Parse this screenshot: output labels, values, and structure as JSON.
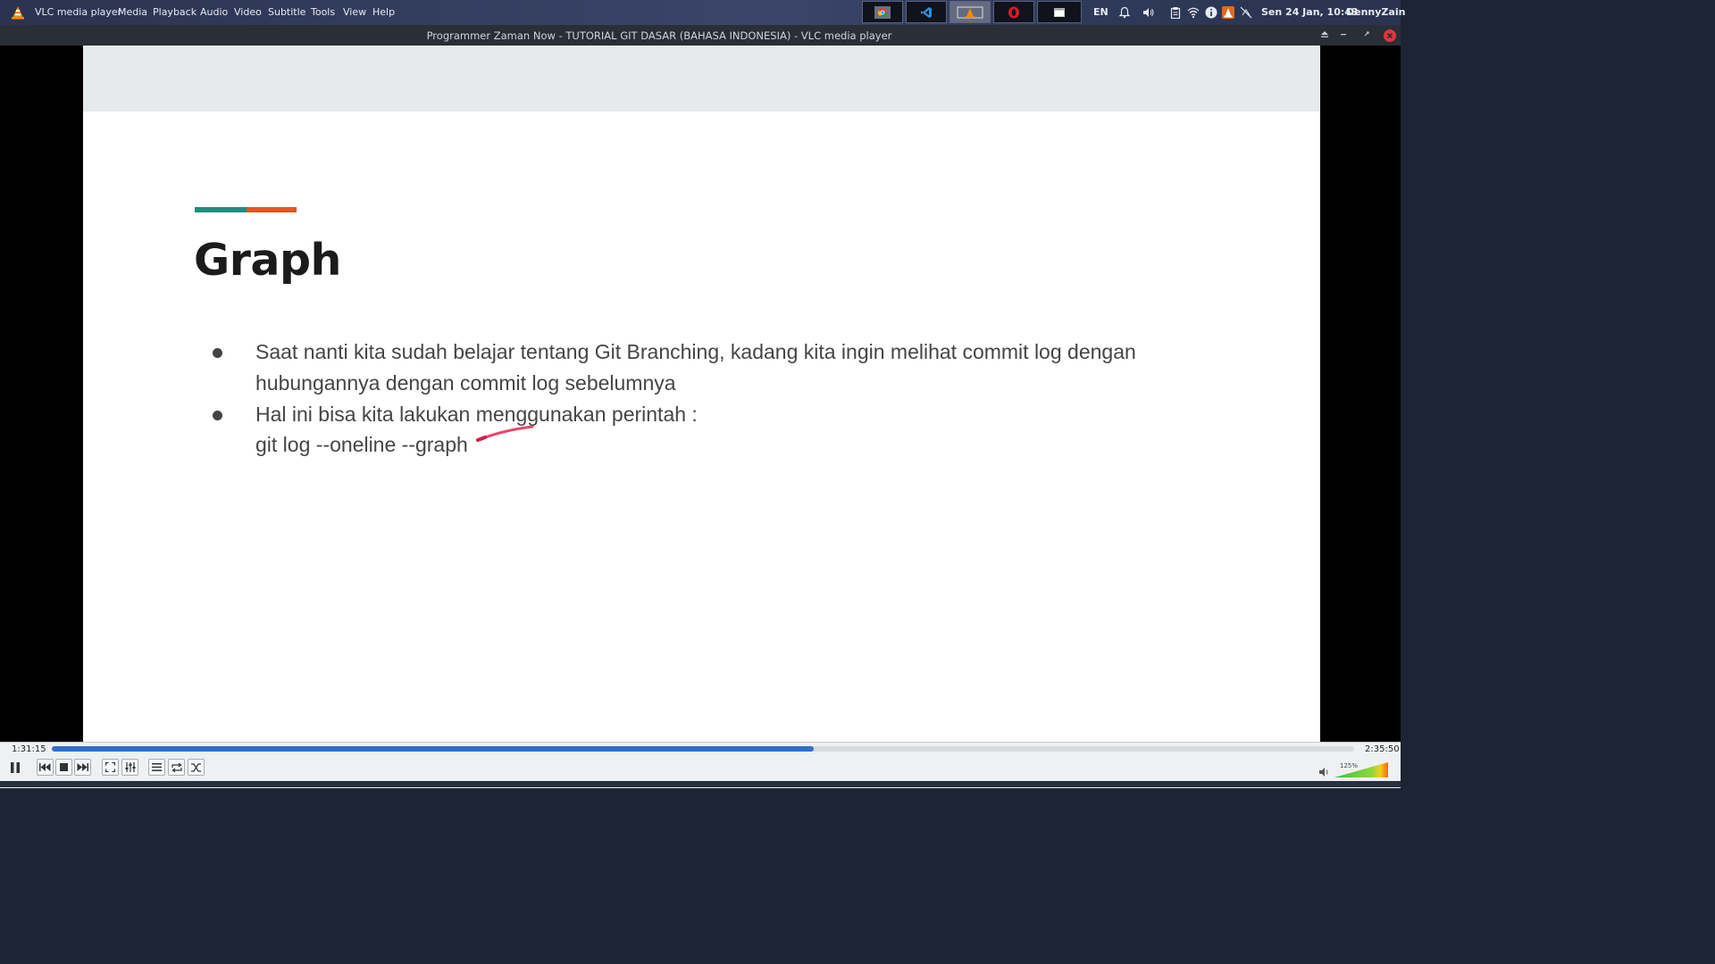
{
  "topbar": {
    "app_name": "VLC media player",
    "menu": [
      "Media",
      "Playback",
      "Audio",
      "Video",
      "Subtitle",
      "Tools",
      "View",
      "Help"
    ],
    "tasks": [
      {
        "icon": "chrome-icon"
      },
      {
        "icon": "vscode-icon"
      },
      {
        "icon": "vlc-icon",
        "active": true
      },
      {
        "icon": "opera-icon"
      },
      {
        "icon": "window-icon"
      }
    ],
    "lang": "EN",
    "clock": "Sen 24 Jan, 10:43",
    "user": "DennyZain"
  },
  "window": {
    "title": "Programmer Zaman Now - TUTORIAL GIT DASAR (BAHASA INDONESIA) - VLC media player"
  },
  "slide": {
    "title": "Graph",
    "bullet1_line1": "Saat nanti kita sudah belajar tentang Git Branching, kadang kita ingin melihat commit log dengan",
    "bullet1_line2": "hubungannya dengan commit log sebelumnya",
    "bullet2_line1": "Hal ini bisa kita lakukan menggunakan perintah :",
    "bullet2_line2": "git log --oneline --graph",
    "colors": {
      "band": "#e6eaea",
      "accent_teal": "#1e8f7e",
      "accent_orange": "#e2571d"
    }
  },
  "player": {
    "elapsed": "1:31:15",
    "total": "2:35:50",
    "progress": 0.585,
    "volume_label": "125%",
    "volume": 1.25
  }
}
